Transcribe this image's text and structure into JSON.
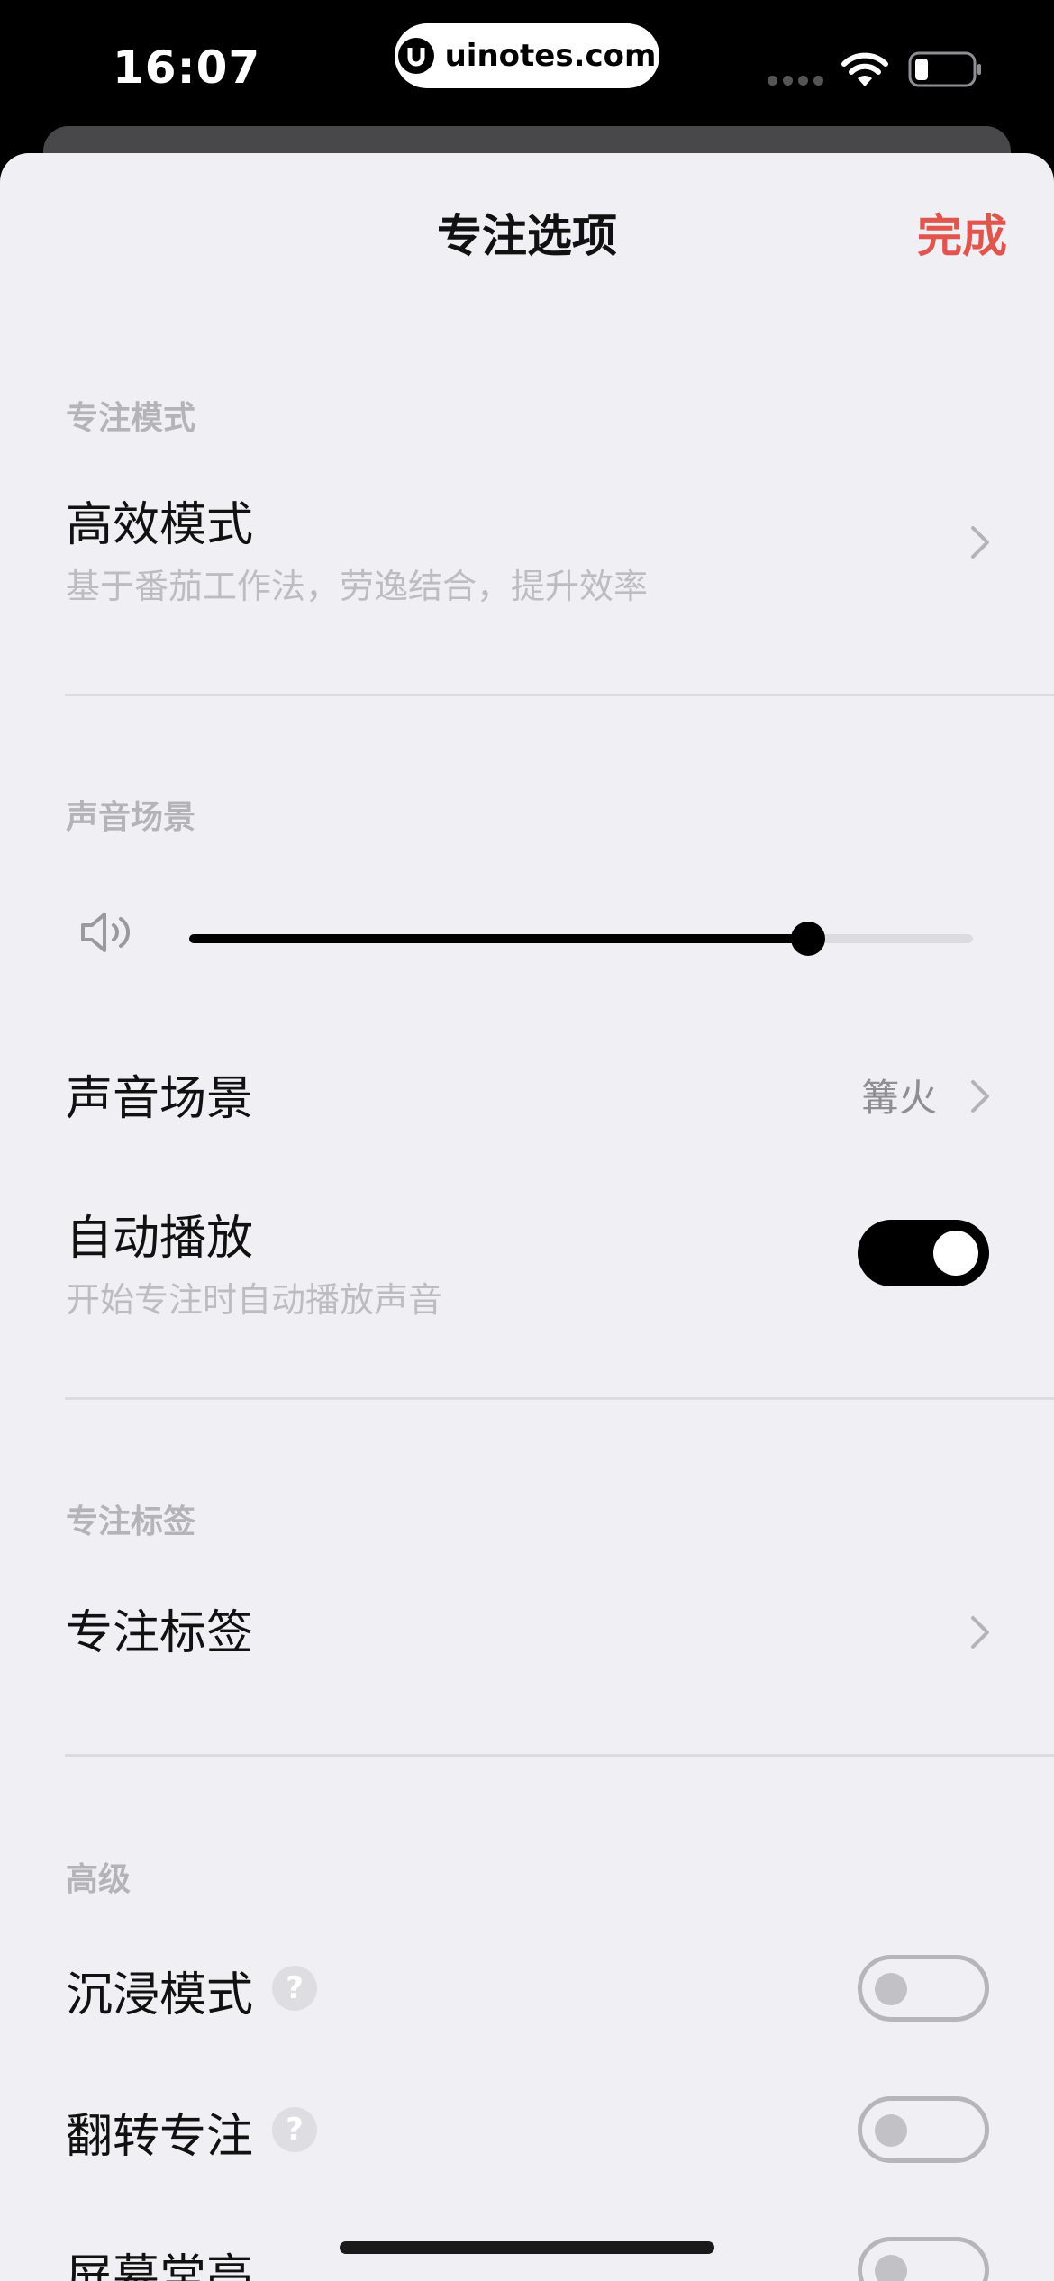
{
  "status_bar": {
    "time": "16:07",
    "url": "uinotes.com"
  },
  "header": {
    "title": "专注选项",
    "done_label": "完成",
    "done_color": "#e0564e"
  },
  "sections": {
    "focus_mode": {
      "header": "专注模式",
      "item_title": "高效模式",
      "item_subtitle": "基于番茄工作法，劳逸结合，提升效率"
    },
    "sound": {
      "header": "声音场景",
      "volume_level": 0.79,
      "scene_label": "声音场景",
      "scene_value": "篝火",
      "autoplay_label": "自动播放",
      "autoplay_subtitle": "开始专注时自动播放声音",
      "autoplay_on": true
    },
    "tags": {
      "header": "专注标签",
      "item_title": "专注标签"
    },
    "advanced": {
      "header": "高级",
      "immersive_label": "沉浸模式",
      "immersive_on": false,
      "flip_label": "翻转专注",
      "flip_on": false,
      "screen_on_label": "屏幕常亮",
      "screen_on_on": false,
      "help_glyph": "?"
    }
  }
}
